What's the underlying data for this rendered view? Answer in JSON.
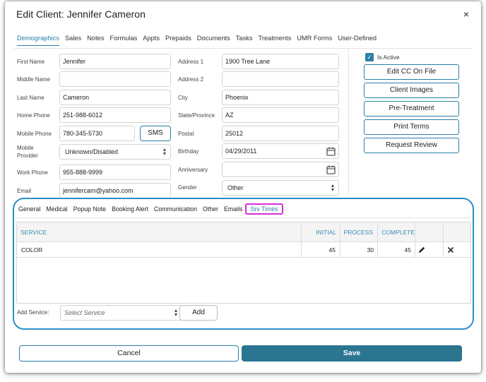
{
  "dialog": {
    "title": "Edit Client: Jennifer Cameron",
    "close_icon": "×"
  },
  "tabs": [
    {
      "label": "Demographics",
      "active": true
    },
    {
      "label": "Sales"
    },
    {
      "label": "Notes"
    },
    {
      "label": "Formulas"
    },
    {
      "label": "Appts"
    },
    {
      "label": "Prepaids"
    },
    {
      "label": "Documents"
    },
    {
      "label": "Tasks"
    },
    {
      "label": "Treatments"
    },
    {
      "label": "UMR Forms"
    },
    {
      "label": "User-Defined"
    }
  ],
  "form": {
    "first_name": {
      "label": "First Name",
      "value": "Jennifer"
    },
    "middle_name": {
      "label": "Middle Name",
      "value": ""
    },
    "last_name": {
      "label": "Last Name",
      "value": "Cameron"
    },
    "home_phone": {
      "label": "Home Phone",
      "value": "251-988-6012"
    },
    "mobile_phone": {
      "label": "Mobile Phone",
      "value": "780-345-5730"
    },
    "sms_label": "SMS",
    "mobile_provider": {
      "label": "Mobile Provider",
      "value": "Unknown/Disabled"
    },
    "work_phone": {
      "label": "Work Phone",
      "value": "955-888-9999"
    },
    "email": {
      "label": "Email",
      "value": "jennifercam@yahoo.com"
    },
    "address1": {
      "label": "Address 1",
      "value": "1900 Tree Lane"
    },
    "address2": {
      "label": "Address 2",
      "value": ""
    },
    "city": {
      "label": "City",
      "value": "Phoenix"
    },
    "state": {
      "label": "State/Province",
      "value": "AZ"
    },
    "postal": {
      "label": "Postal",
      "value": "25012"
    },
    "birthday": {
      "label": "Birthday",
      "value": "04/29/2011"
    },
    "anniversary": {
      "label": "Anniversary",
      "value": ""
    },
    "gender": {
      "label": "Gender",
      "value": "Other"
    }
  },
  "side": {
    "is_active_label": "Is Active",
    "is_active": true,
    "buttons": [
      "Edit CC On File",
      "Client Images",
      "Pre-Treatment",
      "Print Terms",
      "Request Review"
    ]
  },
  "subtabs": [
    {
      "label": "General"
    },
    {
      "label": "Medical"
    },
    {
      "label": "Popup Note"
    },
    {
      "label": "Booking Alert"
    },
    {
      "label": "Communication"
    },
    {
      "label": "Other"
    },
    {
      "label": "Emails"
    },
    {
      "label": "Srv Times",
      "active": true
    }
  ],
  "grid": {
    "headers": {
      "service": "SERVICE",
      "initial": "INITIAL",
      "process": "PROCESS",
      "complete": "COMPLETE"
    },
    "rows": [
      {
        "service": "COLOR",
        "initial": "45",
        "process": "30",
        "complete": "45"
      }
    ]
  },
  "add_service": {
    "label": "Add Service:",
    "placeholder": "Select Service",
    "button": "Add"
  },
  "footer": {
    "cancel": "Cancel",
    "save": "Save"
  },
  "colors": {
    "accent": "#2a7fa6",
    "save_bg": "#2b7590",
    "highlight_circle": "#2b8fcb",
    "highlight_tab": "#d62fd8"
  }
}
